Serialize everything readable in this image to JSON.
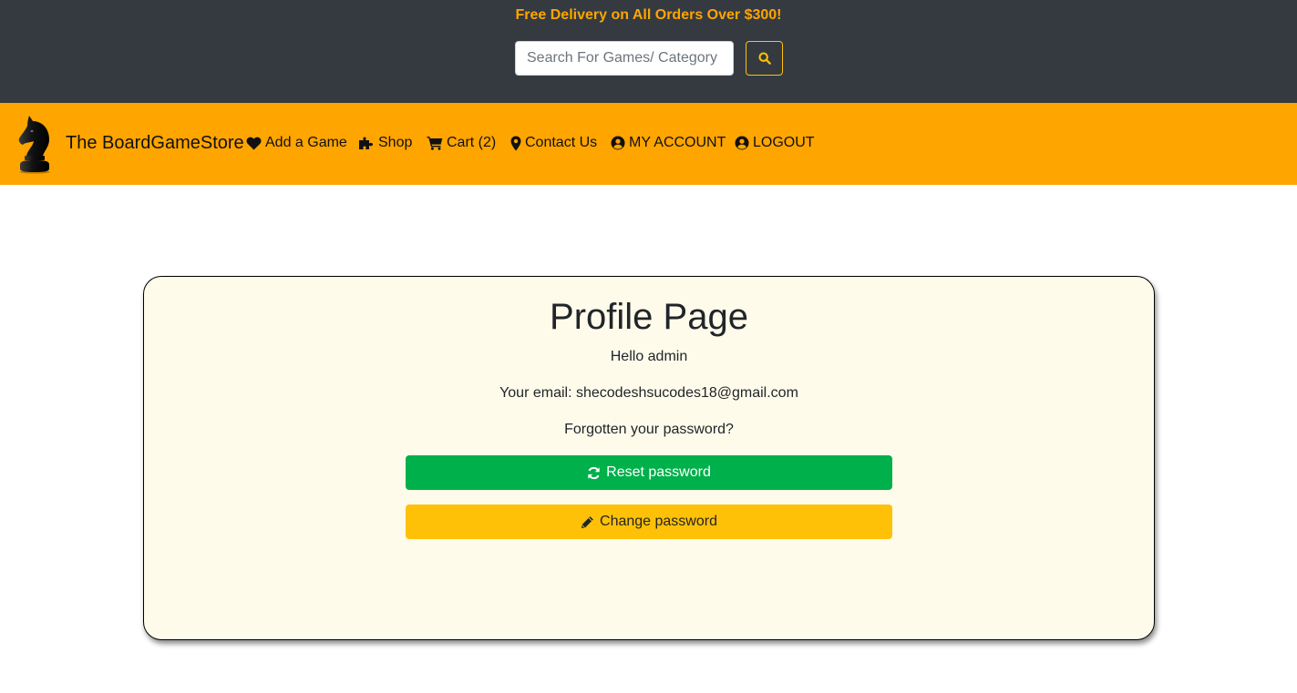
{
  "topbar": {
    "promo": "Free Delivery on All Orders Over $300!",
    "search_placeholder": "Search For Games/ Category",
    "search_value": "",
    "search_button_icon": "search-icon"
  },
  "navbar": {
    "brand": "The BoardGameStore",
    "logo_icon": "chess-knight-icon",
    "items": [
      {
        "label": "Add a Game",
        "icon": "heart-icon"
      },
      {
        "label": "Shop",
        "icon": "puzzle-icon"
      },
      {
        "label": "Cart (2)",
        "icon": "cart-icon"
      },
      {
        "label": "Contact Us",
        "icon": "map-marker-icon"
      },
      {
        "label": "MY ACCOUNT",
        "icon": "user-circle-icon"
      },
      {
        "label": "LOGOUT",
        "icon": "user-circle-icon"
      }
    ]
  },
  "profile": {
    "title": "Profile Page",
    "greeting": "Hello admin",
    "email_line": "Your email: shecodeshsucodes18@gmail.com",
    "forgot_text": "Forgotten your password?",
    "reset_button": "Reset password",
    "reset_icon": "sync-icon",
    "change_button": "Change password",
    "change_icon": "pencil-icon"
  },
  "colors": {
    "topbar_bg": "#343a40",
    "promo_text": "#ffa500",
    "navbar_bg": "#ffa500",
    "card_bg": "#fffbeb",
    "reset_button_bg": "#00b04b",
    "change_button_bg": "#ffc107"
  }
}
